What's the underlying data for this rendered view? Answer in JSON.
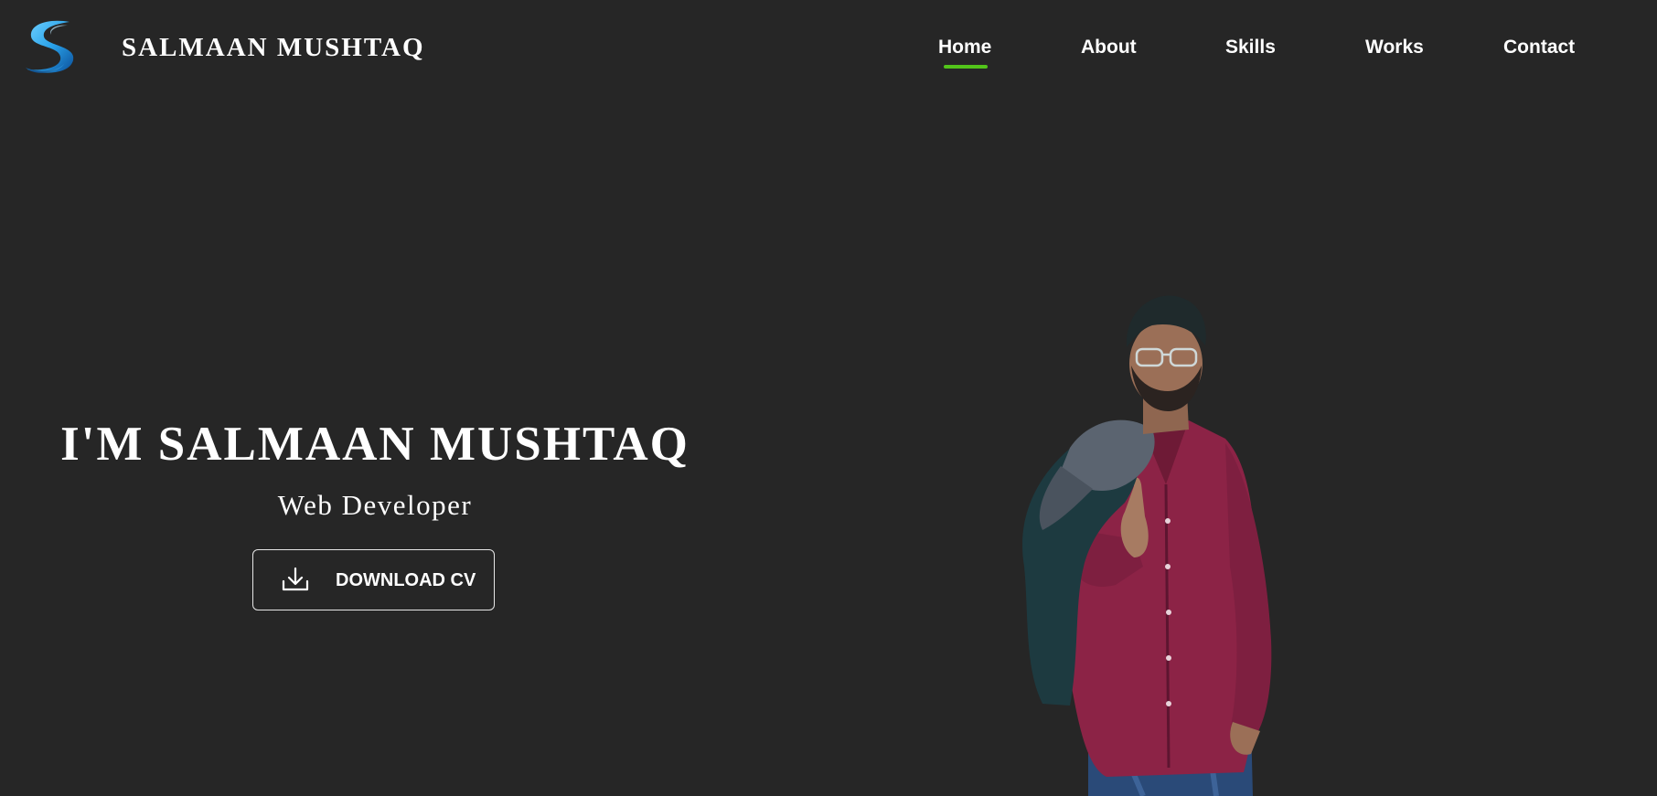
{
  "header": {
    "brand": "SALMAAN MUSHTAQ",
    "logo_icon": "stylized-s-logo",
    "nav": [
      {
        "label": "Home",
        "active": true
      },
      {
        "label": "About",
        "active": false
      },
      {
        "label": "Skills",
        "active": false
      },
      {
        "label": "Works",
        "active": false
      },
      {
        "label": "Contact",
        "active": false
      }
    ]
  },
  "hero": {
    "title": "I'M SALMAAN MUSHTAQ",
    "subtitle": "Web Developer",
    "cv_button": {
      "label": "DOWNLOAD CV",
      "icon": "download-icon"
    },
    "portrait_icon": "person-photo"
  },
  "colors": {
    "background": "#262626",
    "text": "#ffffff",
    "accent": "#52c41a",
    "logo_blue": "#2aa3ea"
  }
}
